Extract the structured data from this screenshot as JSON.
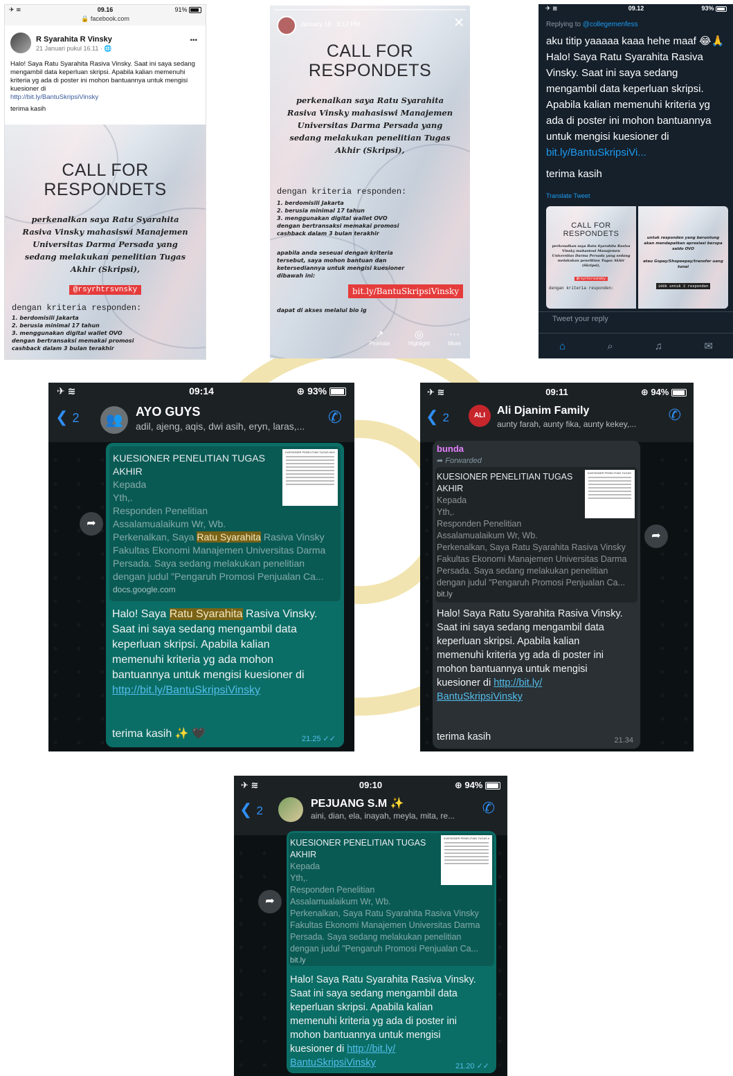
{
  "colors": {
    "wa_bubble_out": "#0b6e66",
    "wa_bubble_in": "#2a3034",
    "link_blue": "#53bdeb",
    "twitter_bg": "#15202b",
    "poster_tag_red": "#e53b3b"
  },
  "poster": {
    "title_line1": "CALL FOR",
    "title_line2": "RESPONDETS",
    "intro": "perkenalkan saya Ratu Syarahita Rasiva Vinsky mahasiswi Manajemen Universitas Darma Persada yang sedang melakukan penelitian Tugas Akhir (Skripsi),",
    "handle": "@rsyrhtrsvnsky",
    "criteria_heading": "dengan kriteria responden:",
    "criteria": [
      "1. berdomisili Jakarta",
      "2. berusia minimal 17 tahun",
      "3. menggunakan digital wallet OVO",
      "dengan bertransaksi memakai promosi",
      "cashback dalam 3 bulan terakhir"
    ],
    "appeal": "apabila anda seseuai dengan kriteria tersebut, saya mohon bantuan dan ketersediannya untuk mengisi kuesioner dibawah ini:",
    "link": "bit.ly/BantuSkripsiVinsky",
    "bio": "dapat di akses melalui bio ig",
    "reward": "untuk responden yang beruntung akan mendapatkan apresiasi berupa saldo OVO",
    "reward2": "atau Gopay/Shopeepay/transfer uang tunai",
    "reward_tag": "100k untuk 2 responden"
  },
  "facebook": {
    "status_time": "09.16",
    "status_url": "facebook.com",
    "status_battery": "91%",
    "author": "R Syarahita R Vinsky",
    "date": "21 Januari pukul 16.11 · ",
    "more": "•••",
    "post_text": "Halo! Saya Ratu Syarahita Rasiva Vinsky. Saat ini saya sedang mengambil data keperluan skripsi. Apabila kalian memenuhi kriteria yg ada di poster ini mohon bantuannya untuk mengisi kuesioner di",
    "post_link": "http://bit.ly/BantuSkripsiVinsky",
    "post_thanks": "terima kasih"
  },
  "instagram": {
    "date": "January 18 · 8:17 PM",
    "close": "✕",
    "actions": [
      {
        "icon": "promote-icon",
        "label": "Promote"
      },
      {
        "icon": "highlight-icon",
        "label": "Highlight"
      },
      {
        "icon": "more-icon",
        "label": "More"
      }
    ]
  },
  "twitter": {
    "status_time": "09.12",
    "status_battery": "93%",
    "replying_prefix": "Replying to ",
    "replying_handle": "@collegemenfess",
    "tweet_line1": "aku titip yaaaaa kaaa hehe maaf 😂🙏",
    "tweet_body": "Halo! Saya Ratu Syarahita Rasiva Vinsky. Saat ini saya sedang mengambil data keperluan skripsi. Apabila kalian memenuhi kriteria yg ada di poster ini mohon bantuannya untuk mengisi kuesioner di ",
    "tweet_link": "bit.ly/BantuSkripsiVi...",
    "tweet_thanks": "terima kasih",
    "translate": "Translate Tweet",
    "reply_placeholder": "Tweet your reply"
  },
  "whatsapp_doc": {
    "title": "KUESIONER PENELITIAN TUGAS AKHIR",
    "lines": [
      "Kepada",
      "Yth,.",
      "Responden Penelitian",
      "Assalamualaikum Wr, Wb."
    ],
    "intro_pre": "Perkenalkan, Saya ",
    "intro_name": "Ratu Syarahita",
    "intro_post": " Rasiva Vinsky",
    "line_fakultas": "Fakultas Ekonomi Manajemen Universitas Darma",
    "line_persada": "Persada. Saya sedang melakukan penelitian",
    "line_judul": "dengan judul \"Pengaruh Promosi Penjualan Ca...",
    "thumb_title": "KUESIONER PENELITIAN TUGAS AKHIR",
    "msg_pre": "Halo! Saya ",
    "msg_name": "Ratu Syarahita",
    "msg_post": " Rasiva Vinsky.",
    "msg_body1": "Saat ini saya sedang mengambil data",
    "msg_body2": "keperluan skripsi. Apabila kalian",
    "msg_body3": "memenuhi kriteria yg ada mohon",
    "msg_body4": "bantuannya untuk mengisi kuesioner di",
    "msg_link": "http://bit.ly/BantuSkripsiVinsky",
    "msg_full": "Halo! Saya Ratu Syarahita Rasiva Vinsky.",
    "msg_b2_1": "Saat ini saya sedang mengambil data",
    "msg_b2_2": "keperluan skripsi. Apabila kalian",
    "msg_b2_3": "memenuhi kriteria yg ada di poster ini",
    "msg_b2_4": "mohon bantuannya untuk mengisi",
    "msg_b2_5": "kuesioner di ",
    "msg_link_a": "http://bit.ly/",
    "msg_link_b": "BantuSkripsiVinsky",
    "thanks": "terima kasih",
    "thanks_emoji": "terima kasih ✨ 🖤"
  },
  "wa_ayo": {
    "status_time": "09:14",
    "battery": "93%",
    "back_count": "2",
    "name": "AYO GUYS",
    "members": "adil, ajeng, aqis, dwi asih, eryn, laras,...",
    "domain": "docs.google.com",
    "time": "21.25 ✓✓"
  },
  "wa_ali": {
    "status_time": "09:11",
    "battery": "94%",
    "back_count": "2",
    "name": "Ali Djanim Family",
    "members": "aunty farah, aunty fika, aunty kekey,...",
    "sender": "bunda",
    "forwarded": "Forwarded",
    "domain": "bit.ly",
    "time": "21.34"
  },
  "wa_pejuang": {
    "status_time": "09:10",
    "battery": "94%",
    "back_count": "2",
    "name": "PEJUANG S.M ✨",
    "members": "aini, dian, ela, inayah, meyla, mita, re...",
    "domain": "bit.ly",
    "time": "21.20 ✓✓"
  }
}
